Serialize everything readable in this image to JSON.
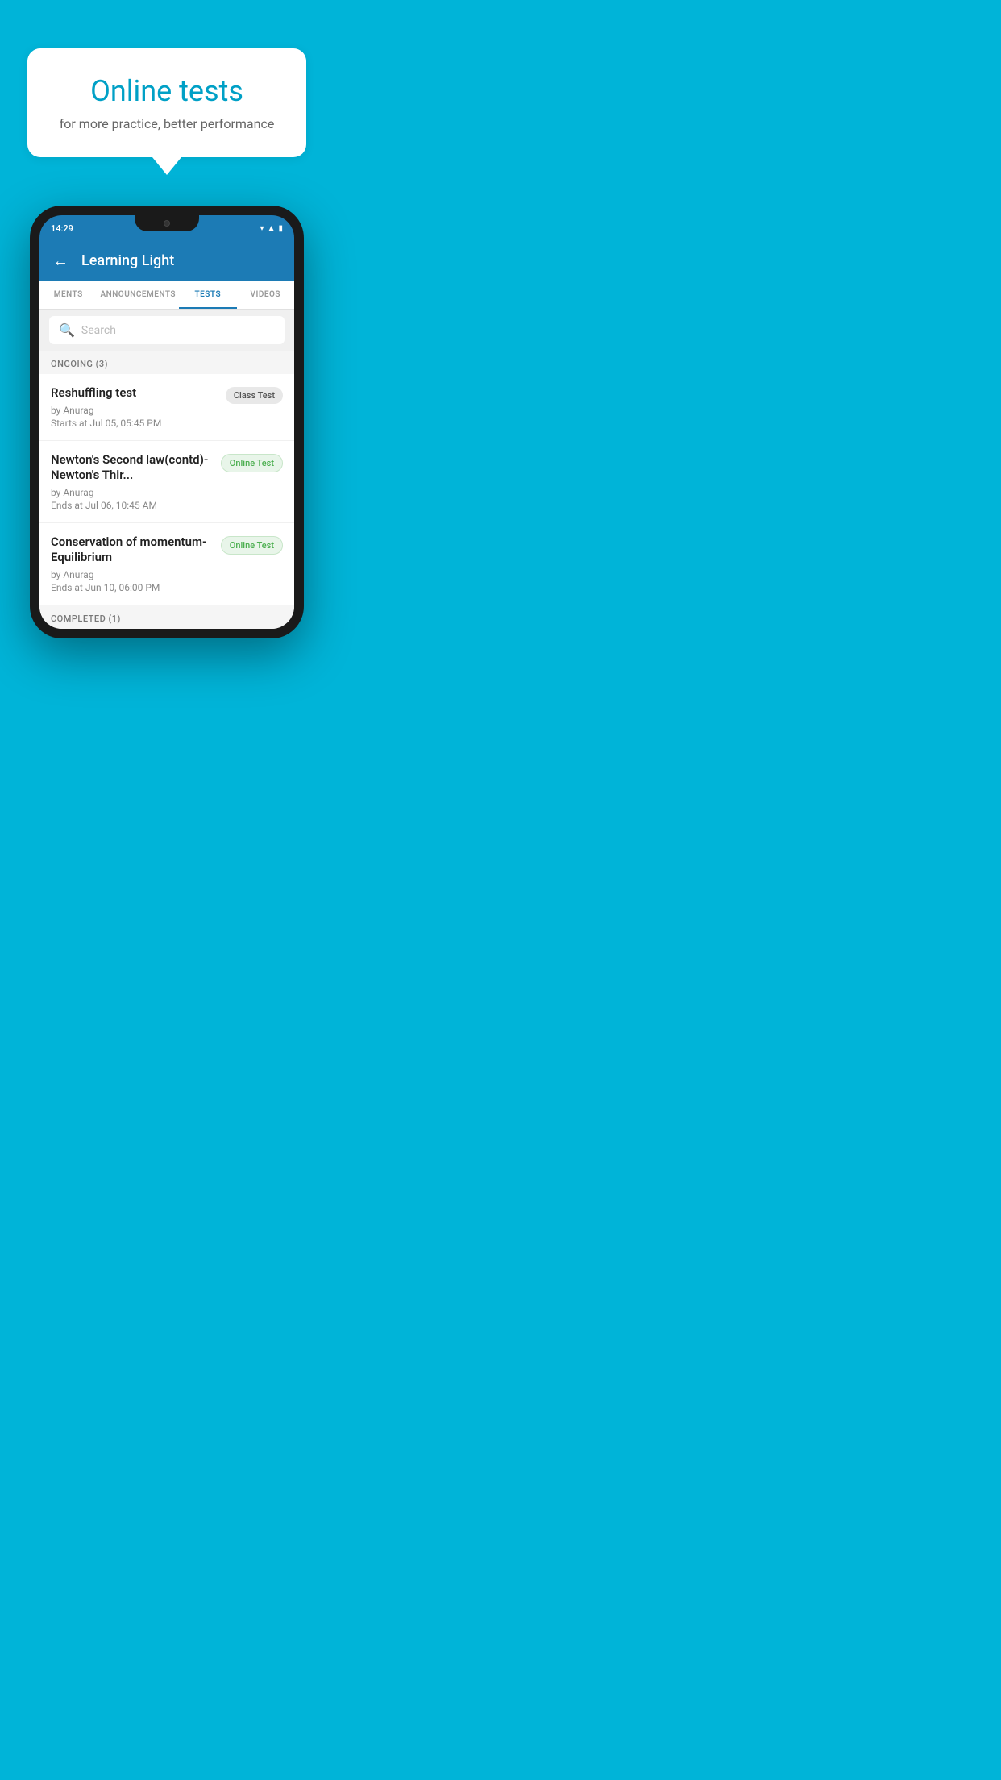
{
  "background": {
    "color": "#00b4d8"
  },
  "bubble": {
    "title": "Online tests",
    "subtitle": "for more practice, better performance"
  },
  "phone": {
    "status": {
      "time": "14:29"
    },
    "header": {
      "back_label": "←",
      "title": "Learning Light"
    },
    "tabs": [
      {
        "label": "MENTS",
        "active": false
      },
      {
        "label": "ANNOUNCEMENTS",
        "active": false
      },
      {
        "label": "TESTS",
        "active": true
      },
      {
        "label": "VIDEOS",
        "active": false
      }
    ],
    "search": {
      "placeholder": "Search"
    },
    "ongoing_section": {
      "label": "ONGOING (3)"
    },
    "tests": [
      {
        "name": "Reshuffling test",
        "by": "by Anurag",
        "date": "Starts at  Jul 05, 05:45 PM",
        "badge": "Class Test",
        "badge_type": "class"
      },
      {
        "name": "Newton's Second law(contd)-Newton's Thir...",
        "by": "by Anurag",
        "date": "Ends at  Jul 06, 10:45 AM",
        "badge": "Online Test",
        "badge_type": "online"
      },
      {
        "name": "Conservation of momentum-Equilibrium",
        "by": "by Anurag",
        "date": "Ends at  Jun 10, 06:00 PM",
        "badge": "Online Test",
        "badge_type": "online"
      }
    ],
    "completed_section": {
      "label": "COMPLETED (1)"
    }
  }
}
